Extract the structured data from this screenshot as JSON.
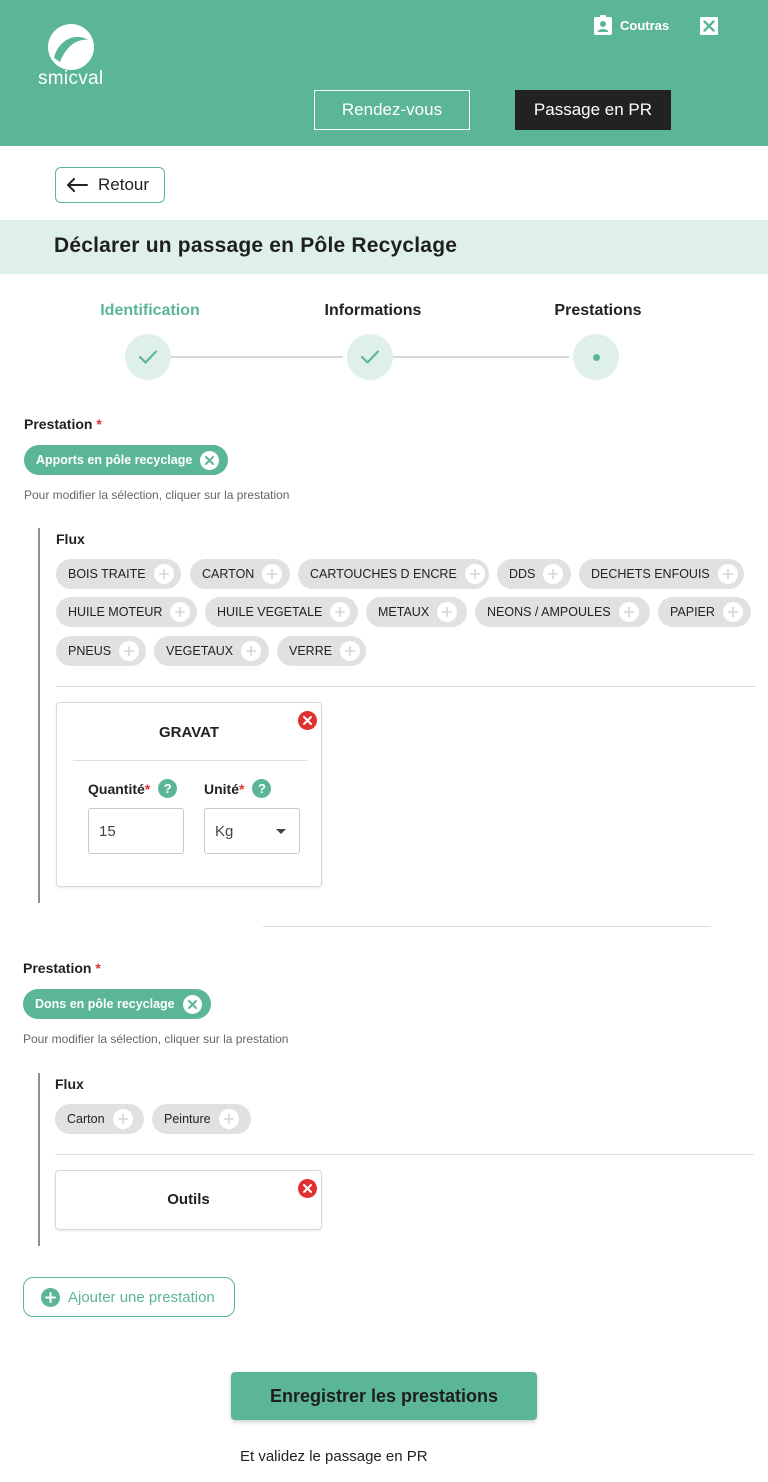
{
  "header": {
    "logo_text": "smicval",
    "user_name": "Coutras",
    "nav": {
      "rendezvous": "Rendez-vous",
      "passage_pr": "Passage en PR"
    }
  },
  "back_label": "Retour",
  "page_title": "Déclarer un passage en Pôle Recyclage",
  "steps": [
    {
      "label": "Identification",
      "status": "done"
    },
    {
      "label": "Informations",
      "status": "done"
    },
    {
      "label": "Prestations",
      "status": "current"
    }
  ],
  "prestation_label": "Prestation",
  "required_mark": "*",
  "hint": "Pour modifier la sélection, cliquer sur la prestation",
  "flux_label": "Flux",
  "prestations": [
    {
      "name": "Apports en pôle recyclage",
      "flux": [
        "BOIS TRAITE",
        "CARTON",
        "CARTOUCHES D ENCRE",
        "DDS",
        "DECHETS ENFOUIS",
        "HUILE MOTEUR",
        "HUILE VEGETALE",
        "METAUX",
        "NEONS / AMPOULES",
        "PAPIER",
        "PNEUS",
        "VEGETAUX",
        "VERRE"
      ],
      "selected": {
        "title": "GRAVAT",
        "quantity_label": "Quantité",
        "unit_label": "Unité",
        "quantity_value": "15",
        "unit_value": "Kg"
      }
    },
    {
      "name": "Dons en pôle recyclage",
      "flux": [
        "Carton",
        "Peinture"
      ],
      "selected": {
        "title": "Outils"
      }
    }
  ],
  "add_prestation_label": "Ajouter une prestation",
  "save_label": "Enregistrer les prestations",
  "footer_note": "Et validez le passage en PR",
  "colors": {
    "brand": "#5bb599",
    "dark": "#222222",
    "band": "#dff0ea",
    "danger": "#e03131"
  }
}
